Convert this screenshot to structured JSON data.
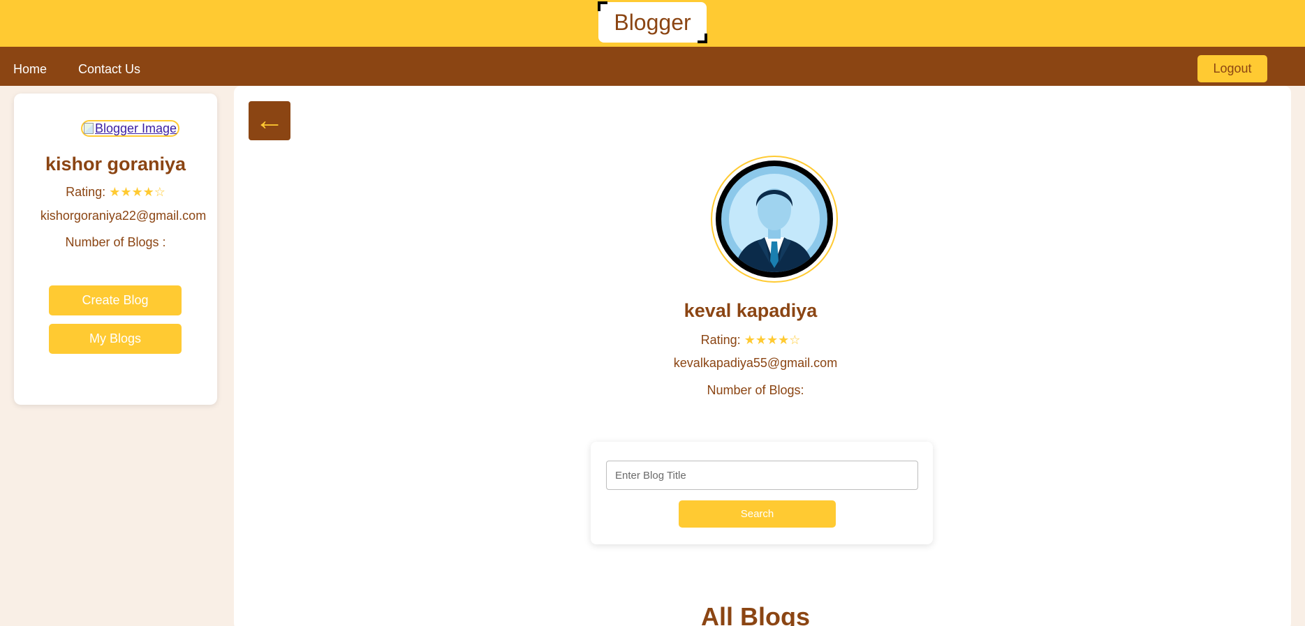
{
  "header": {
    "brand": "Blogger"
  },
  "nav": {
    "home": "Home",
    "contact": "Contact Us",
    "logout": "Logout"
  },
  "sidebar": {
    "image_alt": "Blogger Image",
    "name": "kishor goraniya",
    "rating_label": "Rating:",
    "rating_stars": "★★★★☆",
    "email": "kishorgoraniya22@gmail.com",
    "blogs_label": "Number of Blogs :",
    "create_button": "Create Blog",
    "myblogs_button": "My Blogs"
  },
  "main": {
    "back_icon": "←",
    "profile": {
      "name": "keval kapadiya",
      "rating_label": "Rating:",
      "rating_stars": "★★★★☆",
      "email": "kevalkapadiya55@gmail.com",
      "blogs_label": "Number of Blogs:"
    },
    "search": {
      "placeholder": "Enter Blog Title",
      "button": "Search"
    },
    "section_title": "All Blogs"
  },
  "colors": {
    "accent": "#ffca32",
    "brown": "#8b4513",
    "page_bg": "#f9efe6"
  }
}
